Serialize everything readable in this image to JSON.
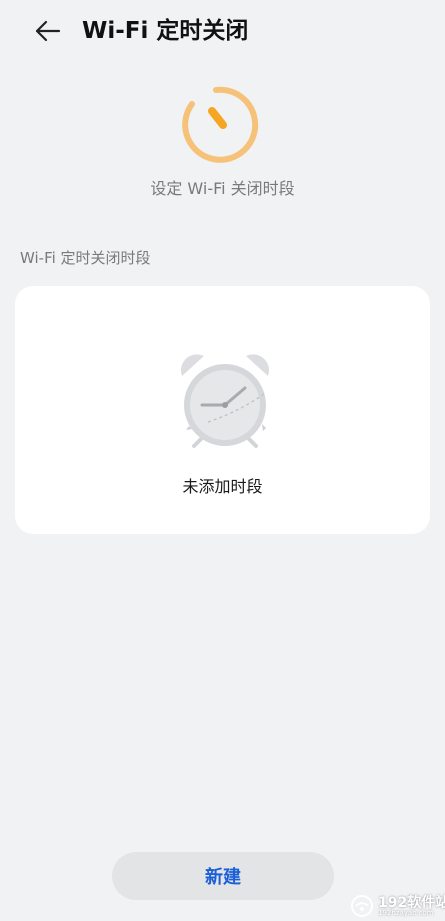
{
  "header": {
    "title": "Wi-Fi 定时关闭",
    "back_icon": "arrow-left-icon"
  },
  "hero": {
    "icon": "timer-icon",
    "subtitle": "设定 Wi-Fi 关闭时段",
    "accent_color": "#f5a623",
    "ring_color": "#f6c279"
  },
  "section": {
    "label": "Wi-Fi 定时关闭时段"
  },
  "empty_state": {
    "icon": "alarm-clock-icon",
    "text": "未添加时段"
  },
  "actions": {
    "new_label": "新建",
    "new_color": "#1a5fd6"
  },
  "watermark": {
    "text": "192软件站",
    "sub": "192hzayao.com"
  }
}
